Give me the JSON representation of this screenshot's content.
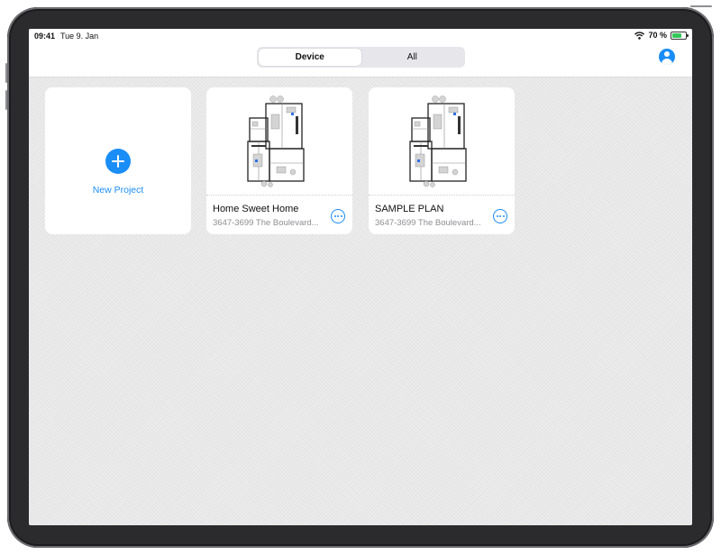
{
  "status_bar": {
    "time": "09:41",
    "date": "Tue 9. Jan",
    "battery_text": "70 %",
    "battery_level": 0.7
  },
  "segmented_control": {
    "options": [
      {
        "label": "Device",
        "selected": true
      },
      {
        "label": "All",
        "selected": false
      }
    ]
  },
  "new_project": {
    "label": "New Project"
  },
  "projects": [
    {
      "title": "Home Sweet Home",
      "address": "3647-3699 The Boulevard..."
    },
    {
      "title": "SAMPLE PLAN",
      "address": "3647-3699 The Boulevard..."
    }
  ],
  "colors": {
    "accent": "#1a8df6",
    "battery": "#34c759",
    "secondary_text": "#8e8e93"
  },
  "icons": {
    "wifi": "wifi-icon",
    "battery": "battery-icon",
    "profile": "profile-icon",
    "plus": "plus-icon",
    "more": "ellipsis-icon"
  }
}
